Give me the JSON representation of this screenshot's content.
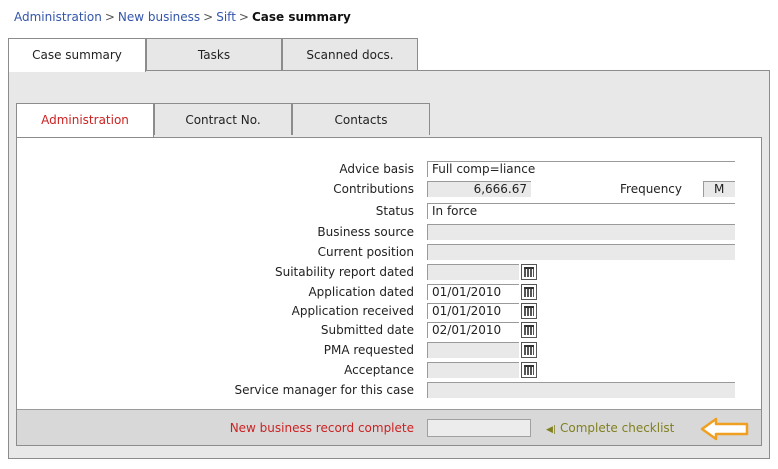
{
  "breadcrumb": {
    "items": [
      "Administration",
      "New business",
      "Sift"
    ],
    "separator": ">",
    "current": "Case summary"
  },
  "tabs": {
    "outer": [
      {
        "label": "Case summary",
        "active": true
      },
      {
        "label": "Tasks",
        "active": false
      },
      {
        "label": "Scanned docs.",
        "active": false
      }
    ],
    "inner": [
      {
        "label": "Administration",
        "active": true
      },
      {
        "label": "Contract No.",
        "active": false
      },
      {
        "label": "Contacts",
        "active": false
      }
    ]
  },
  "form": {
    "advice_basis": {
      "label": "Advice basis",
      "value": "Full comp=liance"
    },
    "contributions": {
      "label": "Contributions",
      "value": "6,666.67"
    },
    "frequency": {
      "label": "Frequency",
      "value": "M"
    },
    "status": {
      "label": "Status",
      "value": "In force"
    },
    "business_source": {
      "label": "Business source",
      "value": ""
    },
    "current_position": {
      "label": "Current position",
      "value": ""
    },
    "suitability_report_dated": {
      "label": "Suitability report dated",
      "value": ""
    },
    "application_dated": {
      "label": "Application dated",
      "value": "01/01/2010"
    },
    "application_received": {
      "label": "Application received",
      "value": "01/01/2010"
    },
    "submitted_date": {
      "label": "Submitted date",
      "value": "02/01/2010"
    },
    "pma_requested": {
      "label": "PMA requested",
      "value": ""
    },
    "acceptance": {
      "label": "Acceptance",
      "value": ""
    },
    "service_manager": {
      "label": "Service manager for this case",
      "value": ""
    }
  },
  "footer": {
    "record_complete_label": "New business record complete",
    "record_complete_value": "",
    "checklist_marker": "◀|",
    "checklist_label": "Complete checklist"
  },
  "colors": {
    "accent_red": "#cc2222",
    "link_blue": "#3355aa",
    "checklist_olive": "#808020",
    "arrow_orange": "#f0a020"
  }
}
